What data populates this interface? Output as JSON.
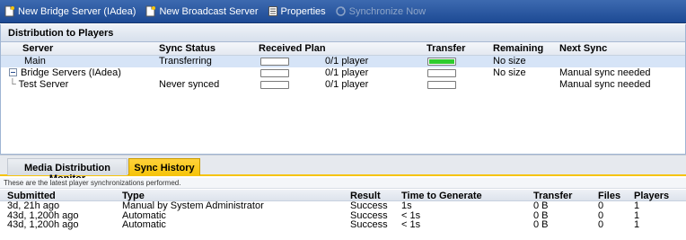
{
  "toolbar": {
    "new_bridge": "New Bridge Server (IAdea)",
    "new_broadcast": "New Broadcast Server",
    "properties": "Properties",
    "synchronize": "Synchronize Now"
  },
  "distribution": {
    "title": "Distribution to Players",
    "columns": {
      "server": "Server",
      "sync_status": "Sync Status",
      "received_plan": "Received Plan",
      "transfer": "Transfer",
      "remaining": "Remaining",
      "next_sync": "Next Sync"
    },
    "rows": [
      {
        "server": "Main",
        "sync_status": "Transferring",
        "received_plan_progress": 0,
        "players": "0/1 player",
        "transfer_progress": 1.0,
        "remaining": "No size",
        "next_sync": ""
      },
      {
        "server": "Bridge Servers (IAdea)",
        "sync_status": "",
        "received_plan_progress": 0,
        "players": "0/1 player",
        "transfer_progress": 0,
        "remaining": "No size",
        "next_sync": "Manual sync needed"
      },
      {
        "server": "Test Server",
        "sync_status": "Never synced",
        "received_plan_progress": 0,
        "players": "0/1 player",
        "transfer_progress": 0,
        "remaining": "",
        "next_sync": "Manual sync needed"
      }
    ]
  },
  "tabs": [
    {
      "label": "Media Distribution Monitor",
      "active": false
    },
    {
      "label": "Sync History",
      "active": true
    }
  ],
  "history": {
    "info": "These are the latest player synchronizations performed.",
    "columns": {
      "submitted": "Submitted",
      "type": "Type",
      "result": "Result",
      "time": "Time to Generate",
      "transfer": "Transfer",
      "files": "Files",
      "players": "Players"
    },
    "rows": [
      {
        "submitted": "3d, 21h ago",
        "type": "Manual by System Administrator",
        "result": "Success",
        "time": "1s",
        "transfer": "0 B",
        "files": "0",
        "players": "1"
      },
      {
        "submitted": "43d, 1,200h ago",
        "type": "Automatic",
        "result": "Success",
        "time": "< 1s",
        "transfer": "0 B",
        "files": "0",
        "players": "1"
      },
      {
        "submitted": "43d, 1,200h ago",
        "type": "Automatic",
        "result": "Success",
        "time": "< 1s",
        "transfer": "0 B",
        "files": "0",
        "players": "1"
      }
    ]
  },
  "colors": {
    "toolbar": "#1d4a94",
    "progress_fill": "#2ecc2e",
    "active_tab": "#f6c40a",
    "selected_row": "#d6e4f7"
  }
}
